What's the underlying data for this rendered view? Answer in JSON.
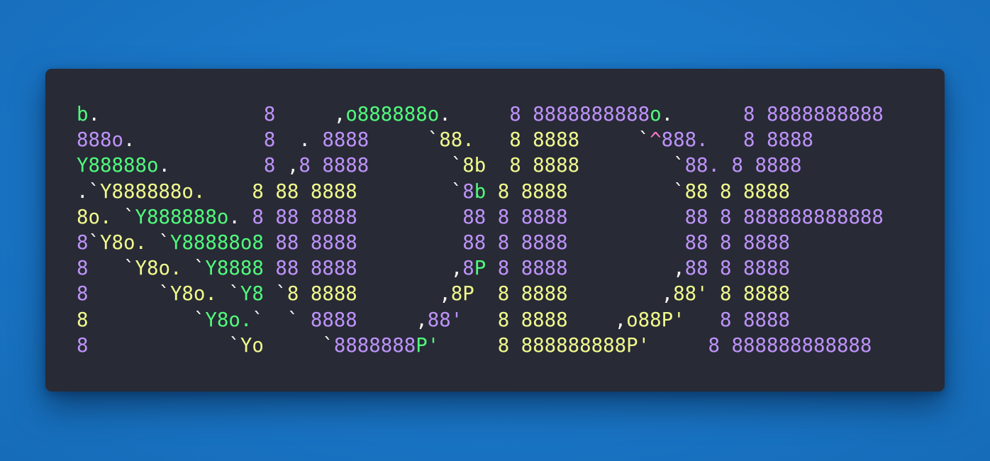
{
  "colors": {
    "background": "#1a78c7",
    "window": "#282a36",
    "green": "#50fa7b",
    "purple": "#bd93f9",
    "yellow": "#f1fa8c",
    "white": "#f8f8f2",
    "pink": "#ff79c6"
  },
  "art": {
    "lines": [
      [
        {
          "t": "b",
          "c": "green"
        },
        {
          "t": ".              ",
          "c": "white"
        },
        {
          "t": "8",
          "c": "purple"
        },
        {
          "t": "     ,",
          "c": "white"
        },
        {
          "t": "o888888o",
          "c": "green"
        },
        {
          "t": ".     ",
          "c": "white"
        },
        {
          "t": "8 8888888888",
          "c": "purple"
        },
        {
          "t": "o",
          "c": "green"
        },
        {
          "t": ".      ",
          "c": "white"
        },
        {
          "t": "8 8888888888",
          "c": "purple"
        }
      ],
      [
        {
          "t": "888o",
          "c": "purple"
        },
        {
          "t": ".           ",
          "c": "white"
        },
        {
          "t": "8",
          "c": "purple"
        },
        {
          "t": "  . ",
          "c": "white"
        },
        {
          "t": "8888",
          "c": "purple"
        },
        {
          "t": "     `",
          "c": "white"
        },
        {
          "t": "88.   8 8888",
          "c": "yellow"
        },
        {
          "t": "     `",
          "c": "white"
        },
        {
          "t": "^",
          "c": "pink"
        },
        {
          "t": "888.   ",
          "c": "purple"
        },
        {
          "t": "8 8888",
          "c": "purple"
        }
      ],
      [
        {
          "t": "Y88888o",
          "c": "green"
        },
        {
          "t": ".        ",
          "c": "white"
        },
        {
          "t": "8",
          "c": "purple"
        },
        {
          "t": " ,",
          "c": "white"
        },
        {
          "t": "8 8888",
          "c": "purple"
        },
        {
          "t": "       `",
          "c": "white"
        },
        {
          "t": "8b  8 8888",
          "c": "yellow"
        },
        {
          "t": "        `",
          "c": "white"
        },
        {
          "t": "88. 8 8888",
          "c": "purple"
        }
      ],
      [
        {
          "t": ".`",
          "c": "white"
        },
        {
          "t": "Y888888o.    ",
          "c": "yellow"
        },
        {
          "t": "8 88 8888",
          "c": "yellow"
        },
        {
          "t": "        `",
          "c": "white"
        },
        {
          "t": "8",
          "c": "purple"
        },
        {
          "t": "b",
          "c": "green"
        },
        {
          "t": " 8 8888",
          "c": "yellow"
        },
        {
          "t": "         `",
          "c": "white"
        },
        {
          "t": "88 8 8888",
          "c": "yellow"
        }
      ],
      [
        {
          "t": "8o. ",
          "c": "yellow"
        },
        {
          "t": "`",
          "c": "white"
        },
        {
          "t": "Y888888o",
          "c": "green"
        },
        {
          "t": ". ",
          "c": "white"
        },
        {
          "t": "8 88 8888",
          "c": "purple"
        },
        {
          "t": "         ",
          "c": "white"
        },
        {
          "t": "88 ",
          "c": "purple"
        },
        {
          "t": "8 8888",
          "c": "purple"
        },
        {
          "t": "          ",
          "c": "white"
        },
        {
          "t": "88 8 888888888888",
          "c": "purple"
        }
      ],
      [
        {
          "t": "8",
          "c": "purple"
        },
        {
          "t": "`",
          "c": "white"
        },
        {
          "t": "Y8o. ",
          "c": "yellow"
        },
        {
          "t": "`",
          "c": "white"
        },
        {
          "t": "Y88888o8",
          "c": "green"
        },
        {
          "t": " 88 8888",
          "c": "purple"
        },
        {
          "t": "         ",
          "c": "white"
        },
        {
          "t": "88 8 8888",
          "c": "purple"
        },
        {
          "t": "          ",
          "c": "white"
        },
        {
          "t": "88 8 8888",
          "c": "purple"
        }
      ],
      [
        {
          "t": "8",
          "c": "purple"
        },
        {
          "t": "   `",
          "c": "white"
        },
        {
          "t": "Y8o. ",
          "c": "yellow"
        },
        {
          "t": "`",
          "c": "white"
        },
        {
          "t": "Y8888",
          "c": "green"
        },
        {
          "t": " 88 8888",
          "c": "purple"
        },
        {
          "t": "        ,",
          "c": "white"
        },
        {
          "t": "8",
          "c": "purple"
        },
        {
          "t": "P",
          "c": "green"
        },
        {
          "t": " 8 8888",
          "c": "purple"
        },
        {
          "t": "         ,",
          "c": "white"
        },
        {
          "t": "88 8 8888",
          "c": "purple"
        }
      ],
      [
        {
          "t": "8",
          "c": "purple"
        },
        {
          "t": "      `",
          "c": "white"
        },
        {
          "t": "Y8o. ",
          "c": "yellow"
        },
        {
          "t": "`",
          "c": "white"
        },
        {
          "t": "Y8",
          "c": "green"
        },
        {
          "t": " `",
          "c": "white"
        },
        {
          "t": "8 8888",
          "c": "yellow"
        },
        {
          "t": "       ,",
          "c": "white"
        },
        {
          "t": "8P  8 8888",
          "c": "yellow"
        },
        {
          "t": "        ,",
          "c": "white"
        },
        {
          "t": "88' 8 8888",
          "c": "yellow"
        }
      ],
      [
        {
          "t": "8",
          "c": "yellow"
        },
        {
          "t": "         `",
          "c": "white"
        },
        {
          "t": "Y8o.",
          "c": "green"
        },
        {
          "t": "`  ` ",
          "c": "white"
        },
        {
          "t": "8888",
          "c": "purple"
        },
        {
          "t": "     ,",
          "c": "white"
        },
        {
          "t": "88'",
          "c": "purple"
        },
        {
          "t": "   8 8888",
          "c": "yellow"
        },
        {
          "t": "    ,",
          "c": "white"
        },
        {
          "t": "o88P'",
          "c": "yellow"
        },
        {
          "t": "   8 8888",
          "c": "purple"
        }
      ],
      [
        {
          "t": "8",
          "c": "purple"
        },
        {
          "t": "            `",
          "c": "white"
        },
        {
          "t": "Yo",
          "c": "yellow"
        },
        {
          "t": "     `",
          "c": "white"
        },
        {
          "t": "8888888",
          "c": "purple"
        },
        {
          "t": "P'",
          "c": "green"
        },
        {
          "t": "     8 888888888",
          "c": "yellow"
        },
        {
          "t": "P'",
          "c": "yellow"
        },
        {
          "t": "     8 888888888888",
          "c": "purple"
        }
      ]
    ]
  }
}
